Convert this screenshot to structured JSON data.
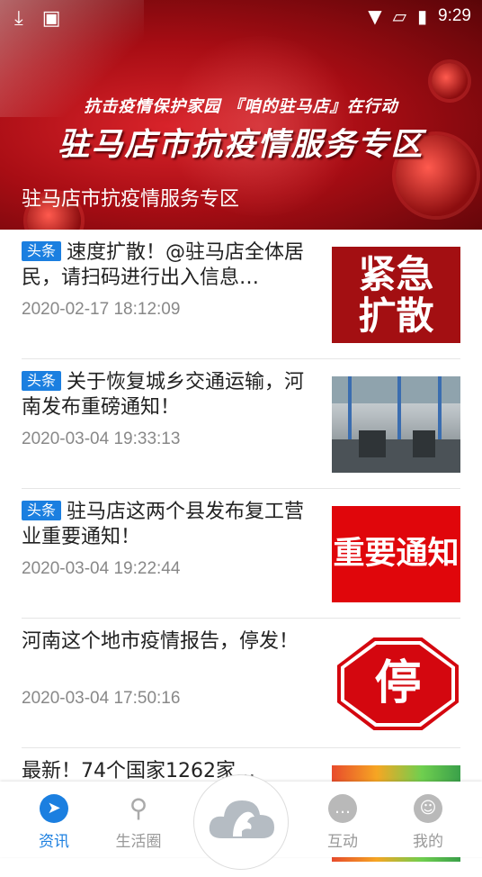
{
  "status_bar": {
    "time": "9:29"
  },
  "banner": {
    "subtitle": "抗击疫情保护家园 『咱的驻马店』在行动",
    "title": "驻马店市抗疫情服务专区",
    "caption": "驻马店市抗疫情服务专区"
  },
  "news": [
    {
      "tag": "头条",
      "title": "速度扩散！@驻马店全体居民，请扫码进行出入信息…",
      "date": "2020-02-17 18:12:09",
      "thumb_text": "紧急扩散"
    },
    {
      "tag": "头条",
      "title": "关于恢复城乡交通运输，河南发布重磅通知！",
      "date": "2020-03-04 19:33:13",
      "thumb_text": ""
    },
    {
      "tag": "头条",
      "title": "驻马店这两个县发布复工营业重要通知！",
      "date": "2020-03-04 19:22:44",
      "thumb_text": "重要通知"
    },
    {
      "tag": "",
      "title": "河南这个地市疫情报告，停发！",
      "date": "2020-03-04 17:50:16",
      "thumb_text": "停"
    },
    {
      "tag": "",
      "title": "最新！74个国家1262家…",
      "date": "",
      "thumb_text": ""
    }
  ],
  "tabs": [
    {
      "label": "资讯",
      "icon": "compass-icon",
      "active": true
    },
    {
      "label": "生活圈",
      "icon": "location-pin-icon",
      "active": false
    },
    {
      "label": "互动",
      "icon": "chat-bubble-icon",
      "active": false
    },
    {
      "label": "我的",
      "icon": "smiley-icon",
      "active": false
    }
  ],
  "colors": {
    "accent": "#1b7fe0",
    "banner_red": "#c3161c"
  }
}
